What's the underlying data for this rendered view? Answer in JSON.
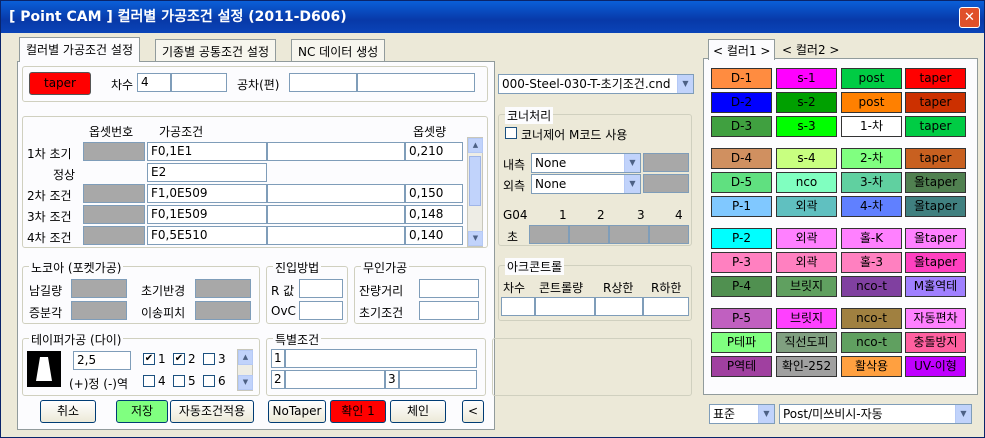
{
  "window": {
    "title": "[ Point CAM ]  컬러별 가공조건 설정  (2011-D606)",
    "close": "✕"
  },
  "tabs": [
    "컬러별 가공조건 설정",
    "기종별 공통조건 설정",
    "NC 데이터 생성"
  ],
  "top": {
    "color_btn": "taper",
    "chasu_label": "차수",
    "chasu_value": "4",
    "gongcha_label": "공차(편)",
    "file_combo": "000-Steel-030-T-초기조건.cnd"
  },
  "conditions": {
    "hdr_offset_no": "옵셋번호",
    "hdr_cond": "가공조건",
    "hdr_offset": "옵셋량",
    "rows": [
      {
        "label": "1차 초기",
        "cond": "F0,1E1",
        "offset": "0,210"
      },
      {
        "label": "정상",
        "cond": "E2",
        "offset": ""
      },
      {
        "label": "2차 조건",
        "cond": "F1,0E509",
        "offset": "0,150"
      },
      {
        "label": "3차 조건",
        "cond": "F0,1E509",
        "offset": "0,148"
      },
      {
        "label": "4차 조건",
        "cond": "F0,5E510",
        "offset": "0,140"
      }
    ]
  },
  "corner": {
    "title": "코너처리",
    "check_label": "코너제어 M코드 사용",
    "inner_label": "내측",
    "inner_value": "None",
    "outer_label": "외측",
    "outer_value": "None",
    "g04_label": "G04",
    "cho_label": "초",
    "cols": [
      "1",
      "2",
      "3",
      "4"
    ]
  },
  "nozzle": {
    "title": "노코아 (포켓가공)",
    "namgil": "남길량",
    "chogi": "초기반경",
    "jeungbun": "증분각",
    "ising": "이송피치"
  },
  "entry": {
    "title": "진입방법",
    "r": "R 값",
    "ovc": "OvC"
  },
  "unmanned": {
    "title": "무인가공",
    "remain": "잔량거리",
    "init": "초기조건"
  },
  "arc": {
    "title": "아크콘트롤",
    "cols": [
      "차수",
      "콘트롤량",
      "R상한",
      "R하한"
    ]
  },
  "taper": {
    "title": "테이퍼가공 (다이)",
    "value": "2,5",
    "sign": "(+)정 (-)역",
    "checks": [
      "1",
      "2",
      "3",
      "4",
      "5",
      "6"
    ]
  },
  "special": {
    "title": "특별조건",
    "n1": "1",
    "n2": "2",
    "n3": "3"
  },
  "bottom": {
    "cancel": "취소",
    "save": "저장",
    "auto_apply": "자동조건적용",
    "notaper": "NoTaper",
    "confirm": "확인 1",
    "chain": "체인",
    "back": "<"
  },
  "right_tabs": [
    "< 컬러1 >",
    "< 컬러2 >"
  ],
  "colors": [
    [
      {
        "t": "D-1",
        "bg": "#ff8c40"
      },
      {
        "t": "s-1",
        "bg": "#ff00ff"
      },
      {
        "t": "post",
        "bg": "#00cc44"
      },
      {
        "t": "taper",
        "bg": "#ff0000"
      }
    ],
    [
      {
        "t": "D-2",
        "bg": "#0000ff"
      },
      {
        "t": "s-2",
        "bg": "#00a000"
      },
      {
        "t": "post",
        "bg": "#ff8000"
      },
      {
        "t": "taper",
        "bg": "#cc3000"
      }
    ],
    [
      {
        "t": "D-3",
        "bg": "#40a040"
      },
      {
        "t": "s-3",
        "bg": "#00ff00"
      },
      {
        "t": "1-차",
        "bg": "#ffffff"
      },
      {
        "t": "taper",
        "bg": "#00cc44"
      }
    ],
    [
      {
        "t": "D-4",
        "bg": "#d09060"
      },
      {
        "t": "s-4",
        "bg": "#c8ff80"
      },
      {
        "t": "2-차",
        "bg": "#80ff80"
      },
      {
        "t": "taper",
        "bg": "#c86020"
      }
    ],
    [
      {
        "t": "D-5",
        "bg": "#60e080"
      },
      {
        "t": "nco",
        "bg": "#80ffc0"
      },
      {
        "t": "3-차",
        "bg": "#60d0a0"
      },
      {
        "t": "올taper",
        "bg": "#508050"
      }
    ],
    [
      {
        "t": "P-1",
        "bg": "#80c8ff"
      },
      {
        "t": "외곽",
        "bg": "#60c0c0"
      },
      {
        "t": "4-차",
        "bg": "#6080ff"
      },
      {
        "t": "올taper",
        "bg": "#408080"
      }
    ],
    [
      {
        "t": "P-2",
        "bg": "#00ffff"
      },
      {
        "t": "외곽",
        "bg": "#ff80ff"
      },
      {
        "t": "홀-K",
        "bg": "#ff80ff"
      },
      {
        "t": "올taper",
        "bg": "#ff80ff"
      }
    ],
    [
      {
        "t": "P-3",
        "bg": "#ff80c0"
      },
      {
        "t": "외곽",
        "bg": "#ff80c0"
      },
      {
        "t": "홀-3",
        "bg": "#ff80c0"
      },
      {
        "t": "올taper",
        "bg": "#ff40c0"
      }
    ],
    [
      {
        "t": "P-4",
        "bg": "#509050"
      },
      {
        "t": "브릿지",
        "bg": "#60a060"
      },
      {
        "t": "nco-t",
        "bg": "#8040a0"
      },
      {
        "t": "M홀역테",
        "bg": "#a080ff"
      }
    ],
    [
      {
        "t": "P-5",
        "bg": "#c060c0"
      },
      {
        "t": "브릿지",
        "bg": "#ff40ff"
      },
      {
        "t": "nco-t",
        "bg": "#a08040"
      },
      {
        "t": "자동편차",
        "bg": "#ff80ff"
      }
    ],
    [
      {
        "t": "P테파",
        "bg": "#80ff80"
      },
      {
        "t": "직선도피",
        "bg": "#80a080"
      },
      {
        "t": "nco-t",
        "bg": "#60a060"
      },
      {
        "t": "충돌방지",
        "bg": "#ff60a0"
      }
    ],
    [
      {
        "t": "P역테",
        "bg": "#a040a0"
      },
      {
        "t": "확인-252",
        "bg": "#a0a0a0"
      },
      {
        "t": "활삭용",
        "bg": "#ffa040"
      },
      {
        "t": "UV-이형",
        "bg": "#c000ff"
      }
    ]
  ],
  "right_bottom": {
    "std": "표준",
    "post": "Post/미쓰비시-자동"
  }
}
